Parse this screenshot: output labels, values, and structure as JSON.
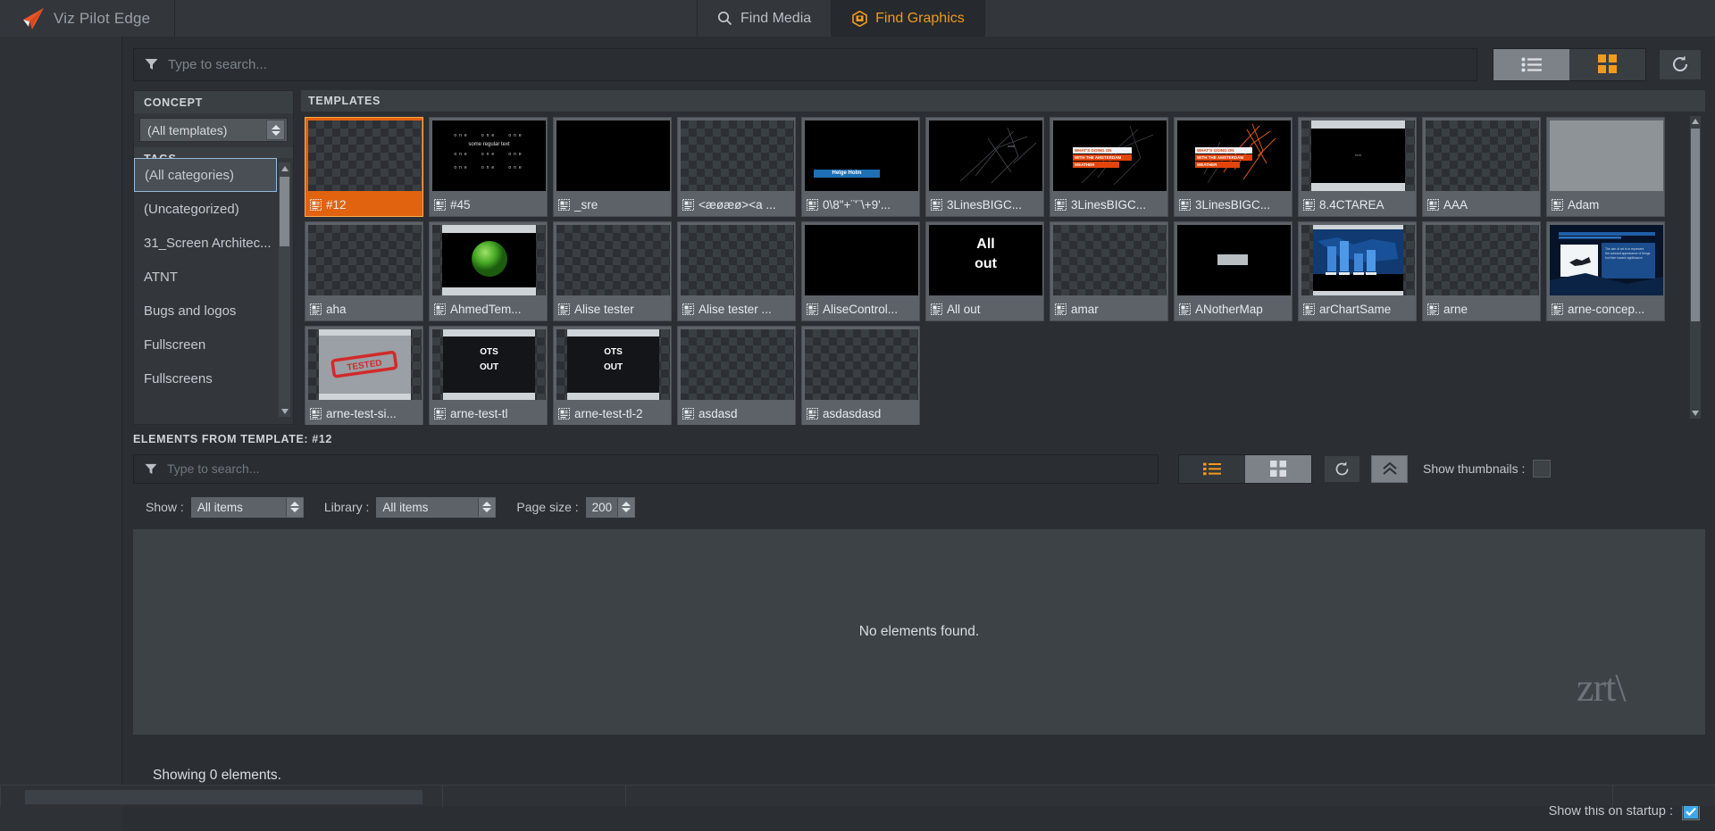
{
  "app": {
    "brand_name": "Viz Pilot Edge",
    "logo_color": "#e8562a"
  },
  "tabs": [
    {
      "label": "Find Media",
      "icon": "search-icon",
      "active": false
    },
    {
      "label": "Find Graphics",
      "icon": "graphics-icon",
      "active": true
    }
  ],
  "accent": "#f09a1e",
  "selection_color": "#e2630f",
  "search": {
    "placeholder": "Type to search...",
    "value": "",
    "filter_icon": "funnel-icon"
  },
  "view_toolbar": {
    "list_view_label": "list-view",
    "grid_view_label": "grid-view",
    "refresh_label": "refresh",
    "active_view": "grid"
  },
  "sidebar": {
    "concept_header": "CONCEPT",
    "concept_value": "(All templates)",
    "tags_header": "TAGS",
    "tags": [
      {
        "label": "(All categories)",
        "selected": true
      },
      {
        "label": "(Uncategorized)",
        "selected": false
      },
      {
        "label": "31_Screen Architec...",
        "selected": false
      },
      {
        "label": "ATNT",
        "selected": false
      },
      {
        "label": "Bugs and logos",
        "selected": false
      },
      {
        "label": "Fullscreen",
        "selected": false
      },
      {
        "label": "Fullscreens",
        "selected": false
      }
    ]
  },
  "templates_panel": {
    "header": "TEMPLATES",
    "items": [
      {
        "name": "#12",
        "selected": true,
        "thumb": "checker"
      },
      {
        "name": "#45",
        "selected": false,
        "thumb": "text-rows"
      },
      {
        "name": "_sre",
        "selected": false,
        "thumb": "black"
      },
      {
        "name": "<æøæø><a ...",
        "selected": false,
        "thumb": "checker"
      },
      {
        "name": "0\\8\"+¨'¨\\+9'...",
        "selected": false,
        "thumb": "lowerthird-blue"
      },
      {
        "name": "3LinesBIGC...",
        "selected": false,
        "thumb": "scratch"
      },
      {
        "name": "3LinesBIGC...",
        "selected": false,
        "thumb": "scratch-bars"
      },
      {
        "name": "3LinesBIGC...",
        "selected": false,
        "thumb": "scratch-orange"
      },
      {
        "name": "8.4CTAREA",
        "selected": false,
        "thumb": "letterbox-black"
      },
      {
        "name": "AAA",
        "selected": false,
        "thumb": "checker"
      },
      {
        "name": "Adam",
        "selected": false,
        "thumb": "gray"
      },
      {
        "name": "aha",
        "selected": false,
        "thumb": "checker"
      },
      {
        "name": "AhmedTem...",
        "selected": false,
        "thumb": "green-sphere"
      },
      {
        "name": "Alise tester",
        "selected": false,
        "thumb": "checker"
      },
      {
        "name": "Alise tester ...",
        "selected": false,
        "thumb": "checker"
      },
      {
        "name": "AliseControl...",
        "selected": false,
        "thumb": "black"
      },
      {
        "name": "All out",
        "selected": false,
        "thumb": "allout"
      },
      {
        "name": "amar",
        "selected": false,
        "thumb": "checker"
      },
      {
        "name": "ANotherMap",
        "selected": false,
        "thumb": "map-black"
      },
      {
        "name": "arChartSame",
        "selected": false,
        "thumb": "chart-blue"
      },
      {
        "name": "arne",
        "selected": false,
        "thumb": "checker"
      },
      {
        "name": "arne-concep...",
        "selected": false,
        "thumb": "concept-blue"
      },
      {
        "name": "arne-test-si...",
        "selected": false,
        "thumb": "red-stamp"
      },
      {
        "name": "arne-test-tl",
        "selected": false,
        "thumb": "ots-out"
      },
      {
        "name": "arne-test-tl-2",
        "selected": false,
        "thumb": "ots-out"
      },
      {
        "name": "asdasd",
        "selected": false,
        "thumb": "checker"
      },
      {
        "name": "asdasdasd",
        "selected": false,
        "thumb": "checker"
      }
    ],
    "thumb_text": {
      "t45_small": "one",
      "t45_regular": "some regular text",
      "lowerthird_name": "Helge Holm",
      "allout_line1": "All",
      "allout_line2": "out",
      "ots_line1": "OTS",
      "ots_line2": "OUT",
      "scratch_l1": "WHAT'S GOING ON",
      "scratch_l2": "WITH THE AMSTERDAM",
      "scratch_l3": "WEATHER"
    }
  },
  "elements_panel": {
    "header": "ELEMENTS FROM TEMPLATE: #12",
    "search_placeholder": "Type to search...",
    "search_value": "",
    "show_thumbnails_label": "Show thumbnails :",
    "show_thumbnails_checked": false,
    "active_view": "list",
    "filters": [
      {
        "label": "Show :",
        "value": "All items"
      },
      {
        "label": "Library :",
        "value": "All items"
      },
      {
        "label": "Page size :",
        "value": "200"
      }
    ],
    "empty_message": "No elements found.",
    "status": "Showing 0 elements."
  },
  "footer": {
    "startup_label": "Show this on startup :",
    "startup_checked": true,
    "watermark": "zrt"
  }
}
